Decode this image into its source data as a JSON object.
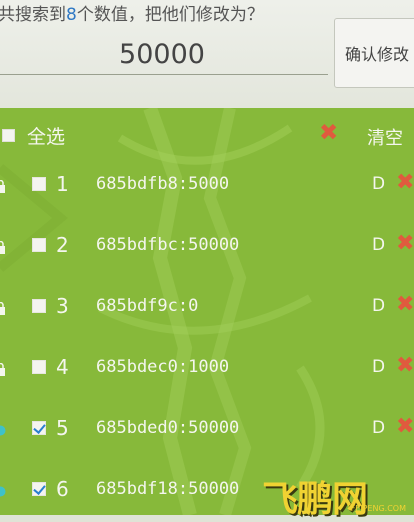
{
  "search": {
    "prompt_prefix": "共搜索到",
    "count": "8",
    "prompt_suffix": "个数值，把他们修改为？",
    "value": "50000",
    "confirm_label": "确认修改"
  },
  "list": {
    "select_all_label": "全选",
    "clear_label": "清空",
    "delete_glyph": "✖",
    "rows": [
      {
        "index": "1",
        "text": "685bdfb8:5000",
        "type": "D",
        "checked": false,
        "icon": "lock-icon"
      },
      {
        "index": "2",
        "text": "685bdfbc:50000",
        "type": "D",
        "checked": false,
        "icon": "lock-icon"
      },
      {
        "index": "3",
        "text": "685bdf9c:0",
        "type": "D",
        "checked": false,
        "icon": "lock-icon"
      },
      {
        "index": "4",
        "text": "685bdec0:1000",
        "type": "D",
        "checked": false,
        "icon": "lock-icon"
      },
      {
        "index": "5",
        "text": "685bded0:50000",
        "type": "D",
        "checked": true,
        "icon": "dot-icon"
      },
      {
        "index": "6",
        "text": "685bdf18:50000",
        "type": "",
        "checked": true,
        "icon": "dot-icon"
      }
    ]
  },
  "watermark": {
    "text": "飞鹏网",
    "sub": "FEIPENG.COM"
  },
  "colors": {
    "panel": "#87b93a",
    "delete": "#e05a3e",
    "count": "#2f78c4",
    "watermark": "#f0d232"
  }
}
